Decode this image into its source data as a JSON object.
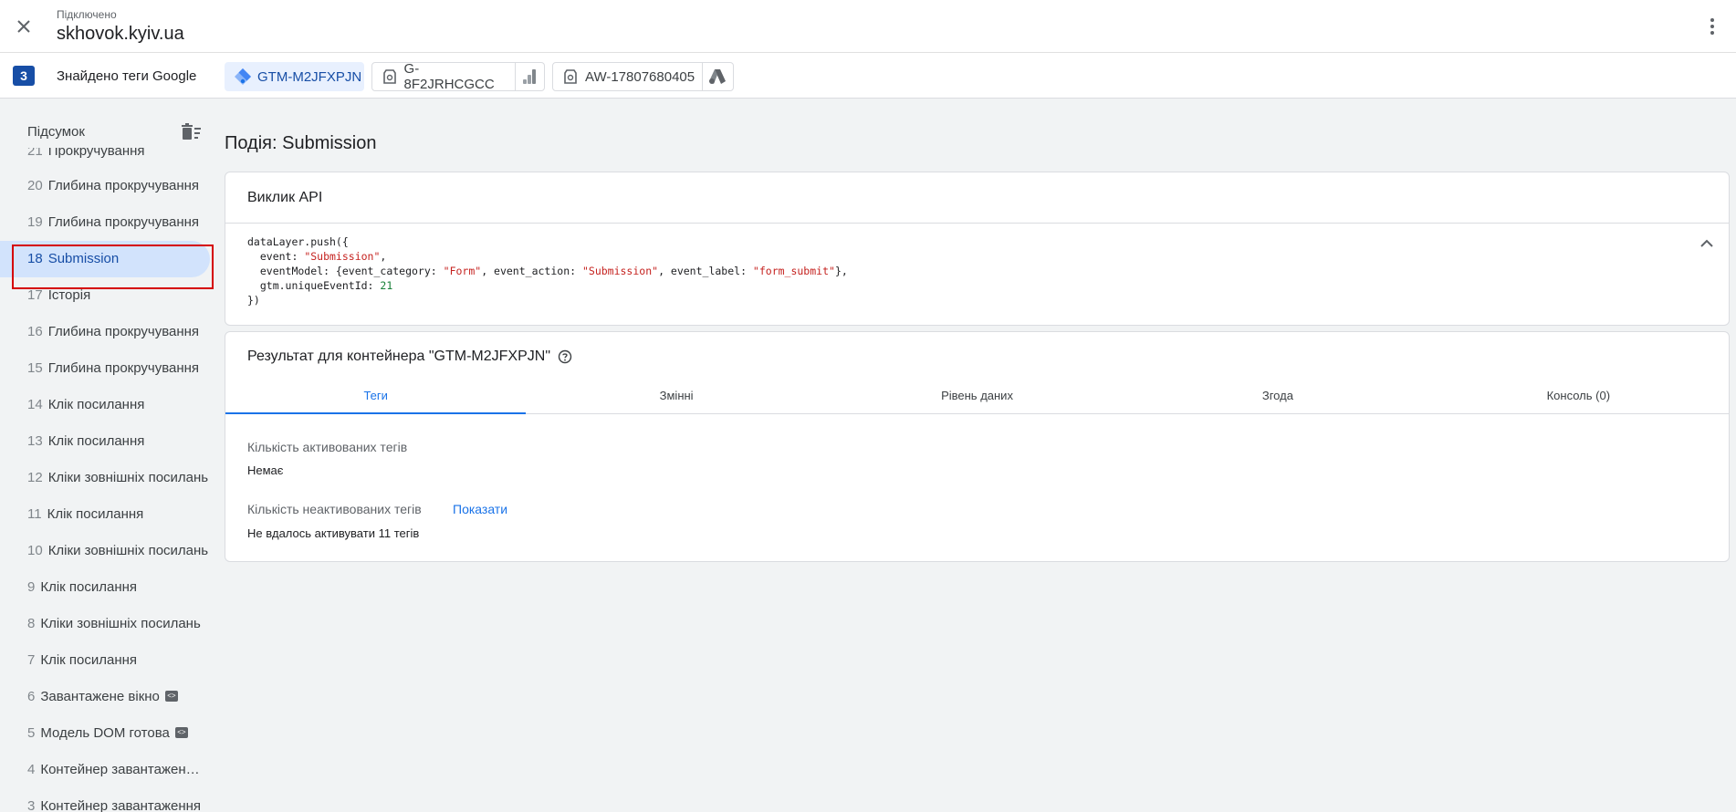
{
  "header": {
    "status": "Підключено",
    "site": "skhovok.kyiv.ua"
  },
  "tagsbar": {
    "count": "3",
    "found_label": "Знайдено теги Google",
    "chips": [
      {
        "label": "GTM-M2JFXPJN",
        "icon": "gtm-diamond-icon",
        "active": true
      },
      {
        "label": "G-8F2JRHCGCC",
        "icon": "tag-icon",
        "right_icon": "analytics-bars-icon"
      },
      {
        "label": "AW-17807680405",
        "icon": "tag-icon",
        "right_icon": "google-ads-icon"
      }
    ]
  },
  "sidebar": {
    "title": "Підсумок",
    "items": [
      {
        "num": "21",
        "label": "Прокручування"
      },
      {
        "num": "20",
        "label": "Глибина прокручування"
      },
      {
        "num": "19",
        "label": "Глибина прокручування"
      },
      {
        "num": "18",
        "label": "Submission"
      },
      {
        "num": "17",
        "label": "Історія"
      },
      {
        "num": "16",
        "label": "Глибина прокручування"
      },
      {
        "num": "15",
        "label": "Глибина прокручування"
      },
      {
        "num": "14",
        "label": "Клік посилання"
      },
      {
        "num": "13",
        "label": "Клік посилання"
      },
      {
        "num": "12",
        "label": "Кліки зовнішніх посилань"
      },
      {
        "num": "11",
        "label": "Клік посилання"
      },
      {
        "num": "10",
        "label": "Кліки зовнішніх посилань"
      },
      {
        "num": "9",
        "label": "Клік посилання"
      },
      {
        "num": "8",
        "label": "Кліки зовнішніх посилань"
      },
      {
        "num": "7",
        "label": "Клік посилання"
      },
      {
        "num": "6",
        "label": "Завантажене вікно"
      },
      {
        "num": "5",
        "label": "Модель DOM готова"
      },
      {
        "num": "4",
        "label": "Контейнер завантажен…"
      },
      {
        "num": "3",
        "label": "Контейнер завантаження"
      }
    ]
  },
  "main": {
    "event_title": "Подія: Submission",
    "api_card": {
      "title": "Виклик API",
      "code": {
        "line1": "dataLayer.push({",
        "event_key": "  event: ",
        "event_val": "\"Submission\"",
        "comma": ",",
        "em_key": "  eventModel: {event_category: ",
        "em_cat": "\"Form\"",
        "em_action_key": ", event_action: ",
        "em_action": "\"Submission\"",
        "em_label_key": ", event_label: ",
        "em_label": "\"form_submit\"",
        "em_end": "},",
        "uid_key": "  gtm.uniqueEventId: ",
        "uid_val": "21",
        "close": "})"
      }
    },
    "result_card": {
      "title": "Результат для контейнера \"GTM-M2JFXPJN\"",
      "tabs": [
        "Теги",
        "Змінні",
        "Рівень даних",
        "Згода",
        "Консоль (0)"
      ],
      "fired_label": "Кількість активованих тегів",
      "fired_value": "Немає",
      "not_fired_label": "Кількість неактивованих тегів",
      "show_link": "Показати",
      "not_fired_value": "Не вдалось активувати 11 тегів"
    }
  }
}
